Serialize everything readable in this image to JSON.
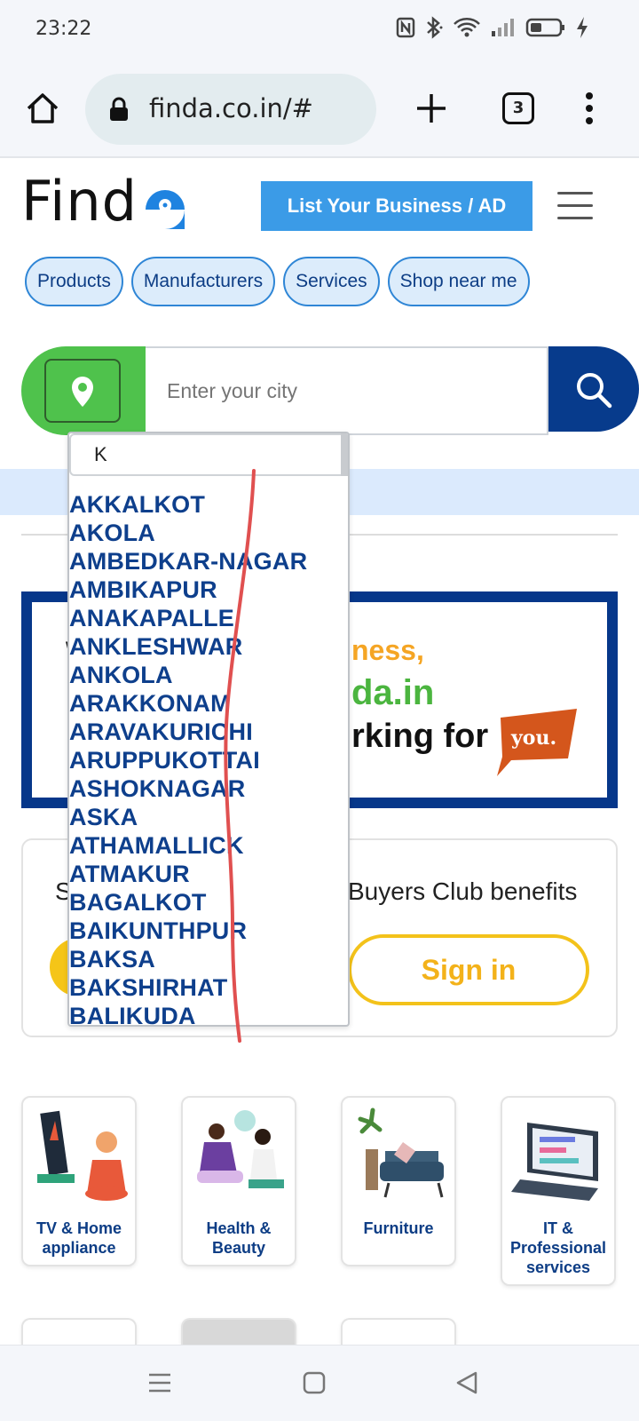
{
  "status_bar": {
    "time": "23:22"
  },
  "browser": {
    "url": "finda.co.in/#",
    "tab_count": "3"
  },
  "header": {
    "logo_text": "Find",
    "list_button": "List Your Business / AD"
  },
  "nav_chips": [
    "Products",
    "Manufacturers",
    "Services",
    "Shop near me"
  ],
  "search": {
    "city_placeholder": "Enter your city"
  },
  "banner": {
    "line1": "W",
    "line2": "ness,",
    "line3": "da.in",
    "line4": "rking for",
    "badge": "you."
  },
  "buyers_club": {
    "prefix": "S",
    "text": "Buyers Club benefits",
    "signin_label": "Sign in"
  },
  "categories": [
    {
      "label": "TV & Home appliance"
    },
    {
      "label": "Health & Beauty"
    },
    {
      "label": "Furniture"
    },
    {
      "label": "IT & Professional services"
    }
  ],
  "city_dropdown": {
    "query": "K",
    "items": [
      "AKKALKOT",
      "AKOLA",
      "AMBEDKAR-NAGAR",
      "AMBIKAPUR",
      "ANAKAPALLE",
      "ANKLESHWAR",
      "ANKOLA",
      "ARAKKONAM",
      "ARAVAKURICHI",
      "ARUPPUKOTTAI",
      "ASHOKNAGAR",
      "ASKA",
      "ATHAMALLICK",
      "ATMAKUR",
      "BAGALKOT",
      "BAIKUNTHPUR",
      "BAKSA",
      "BAKSHIRHAT",
      "BALIKUDA"
    ]
  },
  "colors": {
    "brand_blue": "#06378a",
    "accent_blue": "#3b9be7",
    "location_green": "#4fc24c",
    "signin_yellow": "#f3c21a",
    "annotation_red": "#e05050"
  }
}
